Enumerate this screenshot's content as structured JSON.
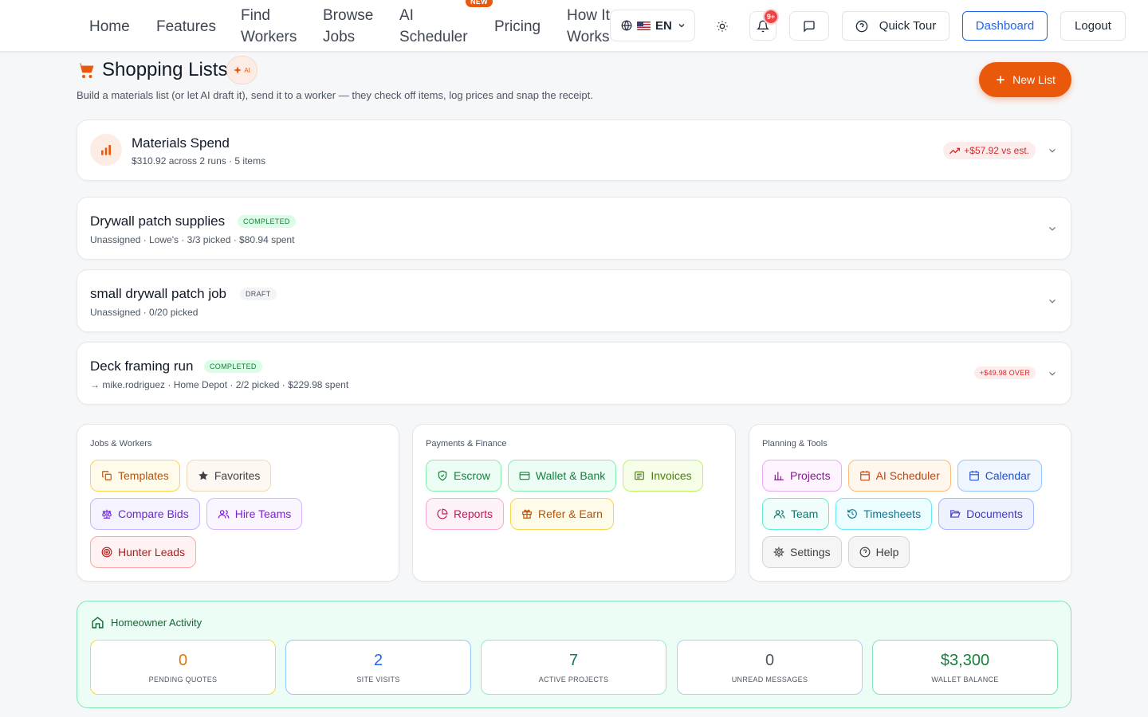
{
  "nav": {
    "home": "Home",
    "features": "Features",
    "find_workers_1": "Find",
    "find_workers_2": "Workers",
    "browse_jobs_1": "Browse",
    "browse_jobs_2": "Jobs",
    "ai_scheduler_1": "AI",
    "ai_scheduler_2": "Scheduler",
    "new_badge": "NEW",
    "pricing": "Pricing",
    "how_it_works_1": "How It",
    "how_it_works_2": "Works",
    "language": "EN",
    "notification_count": "9+",
    "quick_tour": "Quick Tour",
    "dashboard": "Dashboard",
    "logout": "Logout"
  },
  "header": {
    "title": "Shopping Lists",
    "ai_badge": "AI",
    "subtitle": "Build a materials list (or let AI draft it), send it to a worker — they check off items, log prices and snap the receipt.",
    "new_list": "New List"
  },
  "spend": {
    "title": "Materials Spend",
    "summary": "$310.92 across 2 runs · 5 items",
    "delta": "+$57.92 vs est."
  },
  "lists": [
    {
      "title": "Drywall patch supplies",
      "status": "COMPLETED",
      "meta": "Unassigned · Lowe's · 3/3 picked · $80.94 spent"
    },
    {
      "title": "small drywall patch job",
      "status": "DRAFT",
      "meta": "Unassigned · 0/20 picked"
    },
    {
      "title": "Deck framing run",
      "status": "COMPLETED",
      "meta": "→ mike.rodriguez · Home Depot · 2/2 picked · $229.98 spent",
      "over": "+$49.98 OVER"
    }
  ],
  "panels": {
    "jobs": {
      "title": "Jobs & Workers",
      "items": [
        "Templates",
        "Favorites",
        "Compare Bids",
        "Hire Teams",
        "Hunter Leads"
      ]
    },
    "payments": {
      "title": "Payments & Finance",
      "items": [
        "Escrow",
        "Wallet & Bank",
        "Invoices",
        "Reports",
        "Refer & Earn"
      ]
    },
    "planning": {
      "title": "Planning & Tools",
      "items": [
        "Projects",
        "AI Scheduler",
        "Calendar",
        "Team",
        "Timesheets",
        "Documents",
        "Settings",
        "Help"
      ]
    }
  },
  "activity": {
    "title": "Homeowner Activity",
    "stats": [
      {
        "value": "0",
        "label": "PENDING QUOTES",
        "color": "#d97706"
      },
      {
        "value": "2",
        "label": "SITE VISITS",
        "color": "#2563eb"
      },
      {
        "value": "7",
        "label": "ACTIVE PROJECTS",
        "color": "#0f766e"
      },
      {
        "value": "0",
        "label": "UNREAD MESSAGES",
        "color": "#4b5563"
      },
      {
        "value": "$3,300",
        "label": "WALLET BALANCE",
        "color": "#15803d"
      }
    ]
  },
  "colors": {
    "accent": "#ea580c",
    "primary": "#2563eb",
    "success": "#15803d"
  }
}
